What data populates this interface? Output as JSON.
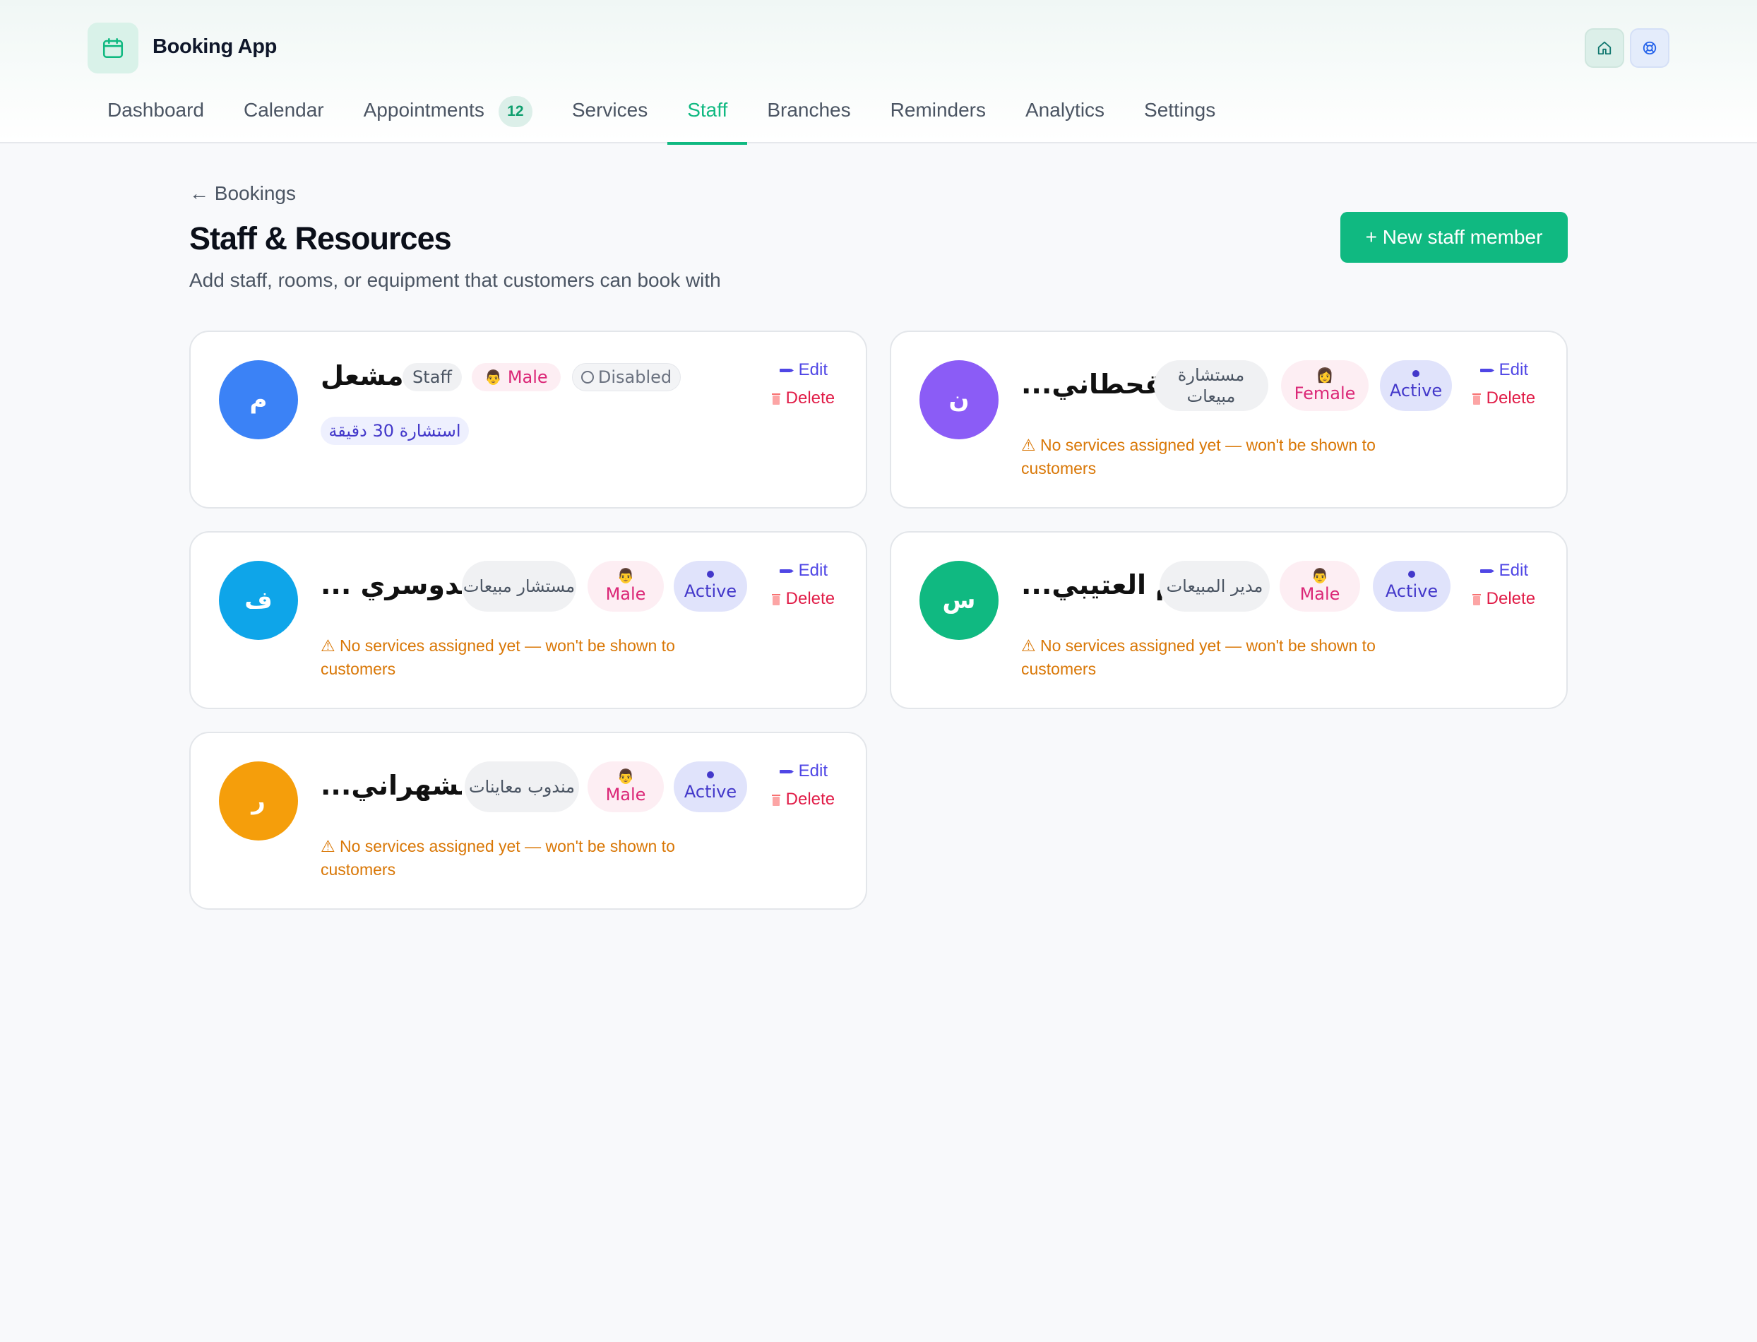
{
  "app": {
    "title": "Booking App"
  },
  "nav": {
    "items": [
      {
        "label": "Dashboard"
      },
      {
        "label": "Calendar"
      },
      {
        "label": "Appointments",
        "badge": "12"
      },
      {
        "label": "Services"
      },
      {
        "label": "Staff"
      },
      {
        "label": "Branches"
      },
      {
        "label": "Reminders"
      },
      {
        "label": "Analytics"
      },
      {
        "label": "Settings"
      }
    ],
    "active": "Staff"
  },
  "page": {
    "back_label": "← Bookings",
    "title": "Staff & Resources",
    "subtitle": "Add staff, rooms, or equipment that customers can book with",
    "new_button": "+ New staff member"
  },
  "actions": {
    "edit": "Edit",
    "delete": "Delete"
  },
  "warning_text": "⚠ No services assigned yet — won't be shown to customers",
  "colors": {
    "accent": "#10b981",
    "avatar_blue": "#3b82f6",
    "avatar_purple": "#8b5cf6",
    "avatar_sky": "#0ea5e9",
    "avatar_green": "#10b981",
    "avatar_orange": "#f59e0b"
  },
  "staff": [
    {
      "initial": "م",
      "name": "مشعل",
      "role": "Staff",
      "gender": "Male",
      "gender_emoji": "👨",
      "status": "Disabled",
      "service": "استشارة 30 دقيقة"
    },
    {
      "initial": "ن",
      "name": "...لقحطاني",
      "role": "مستشارة مبيعات",
      "gender": "Female",
      "gender_emoji": "👩",
      "status": "Active"
    },
    {
      "initial": "ف",
      "name": "... الدوسري",
      "role": "مستشار مبيعات",
      "gender": "Male",
      "gender_emoji": "👨",
      "status": "Active"
    },
    {
      "initial": "س",
      "name": "...م العتيبي",
      "role": "مدير المبيعات",
      "gender": "Male",
      "gender_emoji": "👨",
      "status": "Active"
    },
    {
      "initial": "ر",
      "name": "...الشهراني",
      "role": "مندوب معاينات",
      "gender": "Male",
      "gender_emoji": "👨",
      "status": "Active"
    }
  ]
}
